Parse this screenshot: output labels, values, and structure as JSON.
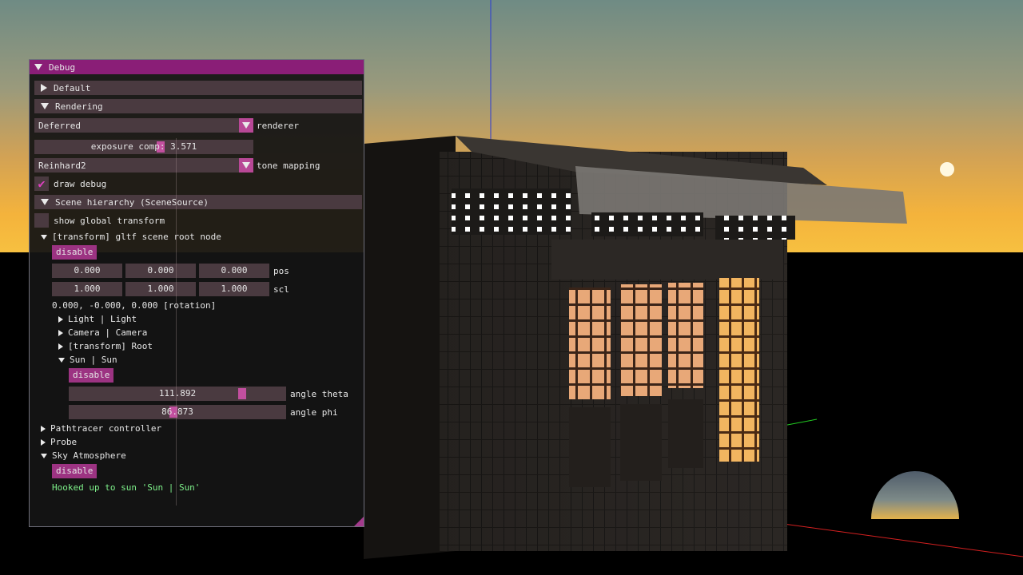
{
  "window": {
    "title": "Debug"
  },
  "sections": {
    "default": "Default",
    "rendering": "Rendering"
  },
  "renderer": {
    "value": "Deferred",
    "label": "renderer"
  },
  "exposure": {
    "text": "exposure comp: 3.571",
    "value": 3.571
  },
  "tone_mapping": {
    "value": "Reinhard2",
    "label": "tone mapping"
  },
  "draw_debug": {
    "label": "draw debug",
    "checked": true
  },
  "scene_hierarchy": {
    "header": "Scene hierarchy (SceneSource)",
    "show_global_transform": {
      "label": "show global transform",
      "checked": false
    },
    "root_node": {
      "label": "[transform] gltf scene root node",
      "disable_label": "disable",
      "pos": {
        "values": [
          "0.000",
          "0.000",
          "0.000"
        ],
        "label": "pos"
      },
      "scl": {
        "values": [
          "1.000",
          "1.000",
          "1.000"
        ],
        "label": "scl"
      },
      "rotation_text": "0.000, -0.000, 0.000 [rotation]",
      "children": {
        "light": "Light | Light",
        "camera": "Camera | Camera",
        "root": "[transform] Root",
        "sun": "Sun | Sun"
      },
      "sun": {
        "disable_label": "disable",
        "theta": {
          "value": "111.892",
          "label": "angle theta",
          "fraction": 0.81
        },
        "phi": {
          "value": "86.873",
          "label": "angle phi",
          "fraction": 0.48
        }
      }
    }
  },
  "pathtracer": "Pathtracer controller",
  "probe": "Probe",
  "sky": {
    "label": "Sky Atmosphere",
    "disable_label": "disable",
    "status": "Hooked up to sun 'Sun | Sun'"
  },
  "colors": {
    "title_bar": "#8a1e77",
    "header_bg": "#4a3a40",
    "button": "#9c3382",
    "accent": "#c24f9f",
    "status_text": "#7ef08a"
  }
}
